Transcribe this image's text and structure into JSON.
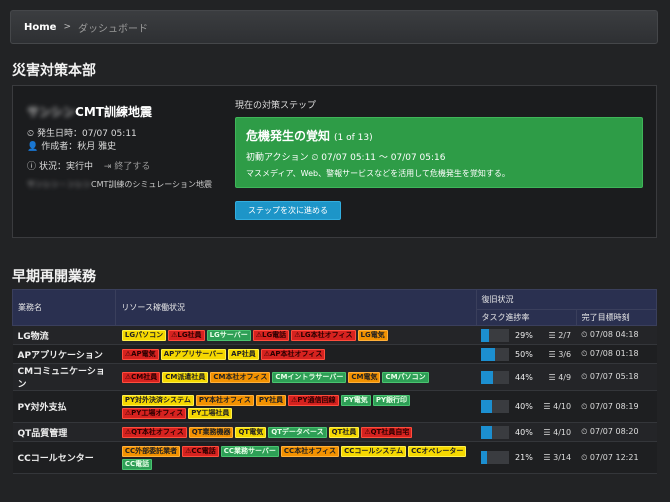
{
  "breadcrumb": {
    "home": "Home",
    "separator": ">",
    "current": "ダッシュボード"
  },
  "hq": {
    "section_title": "災害対策本部",
    "drill_name_blurred": "サンシン",
    "drill_name": "CMT訓練地震",
    "occurred_label": "発生日時：07/07 05:11",
    "author_label": "作成者：秋月 雅史",
    "status_label": "状況：実行中",
    "end_label": "終了する",
    "desc_blurred": "サンシン・ンシン",
    "desc": "CMT訓練のシミュレーション地震",
    "step_label": "現在の対策ステップ",
    "step": {
      "title": "危機発生の覚知",
      "count": "(1 of 13)",
      "action": "初動アクション ⏲ 07/07 05:11 〜 07/07 05:16",
      "desc": "マスメディア、Web、警報サービスなどを活用して危機発生を覚知する。"
    },
    "next_button": "ステップを次に進める"
  },
  "business": {
    "section_title": "早期再開業務",
    "headers": {
      "name": "業務名",
      "resources": "リソース稼働状況",
      "recovery": "復旧状況",
      "progress": "タスク進捗率",
      "deadline": "完了目標時刻"
    },
    "rows": [
      {
        "name": "LG物流",
        "pct": 29,
        "pct_label": "29%",
        "tasks": "2/7",
        "deadline": "07/08 04:18",
        "tags": [
          {
            "label": "LGパソコン",
            "color": "yellow"
          },
          {
            "label": "⚠LG社員",
            "color": "red"
          },
          {
            "label": "LGサーバー",
            "color": "green"
          },
          {
            "label": "⚠LG電話",
            "color": "red"
          },
          {
            "label": "⚠LG本社オフィス",
            "color": "red"
          },
          {
            "label": "LG電気",
            "color": "orange"
          }
        ]
      },
      {
        "name": "APアプリケーション",
        "pct": 50,
        "pct_label": "50%",
        "tasks": "3/6",
        "deadline": "07/08 01:18",
        "tags": [
          {
            "label": "⚠AP電気",
            "color": "red"
          },
          {
            "label": "APアプリサーバー",
            "color": "yellow"
          },
          {
            "label": "AP社員",
            "color": "yellow"
          },
          {
            "label": "⚠AP本社オフィス",
            "color": "red"
          }
        ]
      },
      {
        "name": "CMコミュニケーション",
        "pct": 44,
        "pct_label": "44%",
        "tasks": "4/9",
        "deadline": "07/07 05:18",
        "tags": [
          {
            "label": "⚠CM社員",
            "color": "red"
          },
          {
            "label": "CM派遣社員",
            "color": "yellow"
          },
          {
            "label": "CM本社オフィス",
            "color": "orange"
          },
          {
            "label": "CMイントラサーバー",
            "color": "green"
          },
          {
            "label": "CM電気",
            "color": "orange"
          },
          {
            "label": "CMパソコン",
            "color": "green"
          }
        ]
      },
      {
        "name": "PY対外支払",
        "pct": 40,
        "pct_label": "40%",
        "tasks": "4/10",
        "deadline": "07/07 08:19",
        "tags": [
          {
            "label": "PY対外決済システム",
            "color": "yellow"
          },
          {
            "label": "PY本社オフィス",
            "color": "orange"
          },
          {
            "label": "PY社員",
            "color": "orange"
          },
          {
            "label": "⚠PY通信回線",
            "color": "red"
          },
          {
            "label": "PY電気",
            "color": "green"
          },
          {
            "label": "PY銀行印",
            "color": "green"
          },
          {
            "label": "⚠PY工場オフィス",
            "color": "red"
          },
          {
            "label": "PY工場社員",
            "color": "yellow"
          }
        ]
      },
      {
        "name": "QT品質管理",
        "pct": 40,
        "pct_label": "40%",
        "tasks": "4/10",
        "deadline": "07/07 08:20",
        "tags": [
          {
            "label": "⚠QT本社オフィス",
            "color": "red"
          },
          {
            "label": "QT業務機器",
            "color": "orange"
          },
          {
            "label": "QT電気",
            "color": "yellow"
          },
          {
            "label": "QTデータベース",
            "color": "green"
          },
          {
            "label": "QT社員",
            "color": "yellow"
          },
          {
            "label": "⚠QT社員自宅",
            "color": "red"
          }
        ]
      },
      {
        "name": "CCコールセンター",
        "pct": 21,
        "pct_label": "21%",
        "tasks": "3/14",
        "deadline": "07/07 12:21",
        "tags": [
          {
            "label": "CC外部委託業者",
            "color": "orange"
          },
          {
            "label": "⚠CC電話",
            "color": "red"
          },
          {
            "label": "CC業務サーバー",
            "color": "green"
          },
          {
            "label": "CC本社オフィス",
            "color": "orange"
          },
          {
            "label": "CCコールシステム",
            "color": "yellow"
          },
          {
            "label": "CCオペレーター",
            "color": "yellow"
          },
          {
            "label": "CC電話",
            "color": "green"
          }
        ]
      }
    ]
  }
}
